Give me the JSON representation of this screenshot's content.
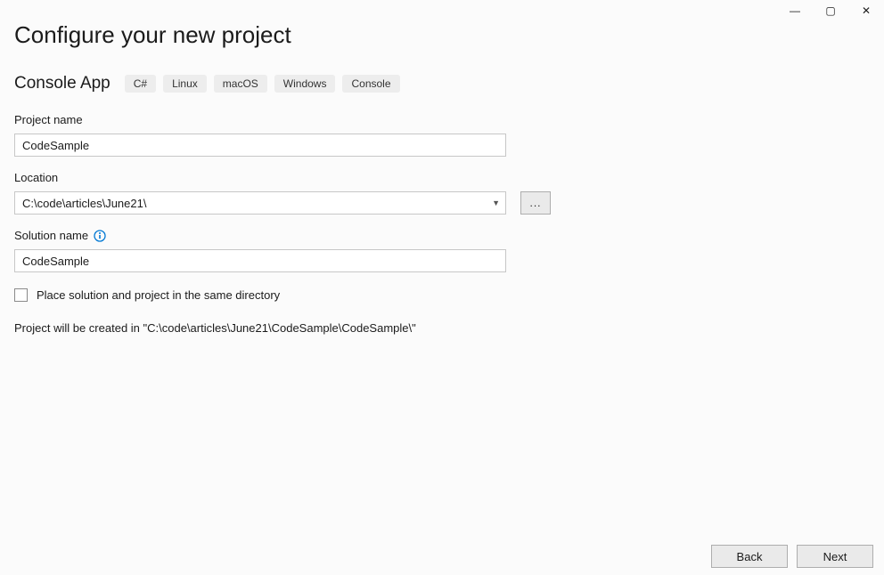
{
  "window": {
    "minimize_glyph": "—",
    "maximize_glyph": "▢",
    "close_glyph": "✕"
  },
  "header": {
    "title": "Configure your new project",
    "subtitle": "Console App",
    "tags": [
      "C#",
      "Linux",
      "macOS",
      "Windows",
      "Console"
    ]
  },
  "fields": {
    "project_name_label": "Project name",
    "project_name_value": "CodeSample",
    "location_label": "Location",
    "location_value": "C:\\code\\articles\\June21\\",
    "browse_label": "...",
    "solution_name_label": "Solution name",
    "solution_name_value": "CodeSample",
    "same_dir_label": "Place solution and project in the same directory"
  },
  "summary": {
    "text": "Project will be created in \"C:\\code\\articles\\June21\\CodeSample\\CodeSample\\\""
  },
  "footer": {
    "back": "Back",
    "next": "Next"
  }
}
